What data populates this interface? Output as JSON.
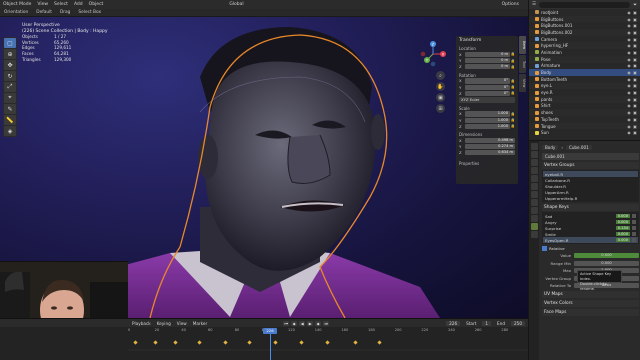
{
  "topbar": {
    "mode": "Object Mode",
    "menus": [
      "View",
      "Select",
      "Add",
      "Object"
    ],
    "transform_orientation": "Global",
    "options": "Options"
  },
  "header2": {
    "orientation_label": "Orientation",
    "orientation_value": "Default",
    "drag_label": "Drag",
    "drag_value": "Select Box"
  },
  "viewport": {
    "title": "User Perspective",
    "subtitle": "(226) Scene Collection | Body : Happy",
    "stats": [
      {
        "k": "Objects",
        "v": "1 / 27"
      },
      {
        "k": "Vertices",
        "v": "65,260"
      },
      {
        "k": "Edges",
        "v": "129,611"
      },
      {
        "k": "Faces",
        "v": "64,281"
      },
      {
        "k": "Triangles",
        "v": "129,300"
      }
    ],
    "gizmo_axes": {
      "x": "X",
      "y": "Y",
      "z": "Z"
    }
  },
  "npanel": {
    "title": "Transform",
    "location_label": "Location",
    "location": [
      {
        "ax": "X",
        "v": "0 m"
      },
      {
        "ax": "Y",
        "v": "0 m"
      },
      {
        "ax": "Z",
        "v": "0 m"
      }
    ],
    "rotation_label": "Rotation",
    "rotation": [
      {
        "ax": "X",
        "v": "0°"
      },
      {
        "ax": "Y",
        "v": "0°"
      },
      {
        "ax": "Z",
        "v": "0°"
      }
    ],
    "rotation_mode": "XYZ Euler",
    "scale_label": "Scale",
    "scale": [
      {
        "ax": "X",
        "v": "1.000"
      },
      {
        "ax": "Y",
        "v": "1.000"
      },
      {
        "ax": "Z",
        "v": "1.000"
      }
    ],
    "dimensions_label": "Dimensions",
    "dimensions": [
      {
        "ax": "X",
        "v": "0.498 m"
      },
      {
        "ax": "Y",
        "v": "0.274 m"
      },
      {
        "ax": "Z",
        "v": "0.634 m"
      }
    ],
    "properties_label": "Properties",
    "tabs": [
      "Item",
      "Tool",
      "View"
    ]
  },
  "timeline": {
    "menus": [
      "Playback",
      "Keying",
      "View",
      "Marker"
    ],
    "current_frame": "226",
    "start_label": "Start",
    "start": "1",
    "end_label": "End",
    "end": "250",
    "ruler": [
      "0",
      "20",
      "40",
      "60",
      "80",
      "100",
      "120",
      "140",
      "160",
      "180",
      "200",
      "220",
      "240",
      "260",
      "280"
    ]
  },
  "outliner": {
    "rows": [
      {
        "name": "rootJoint",
        "color": "#c29450",
        "sel": false
      },
      {
        "name": "BigButtons",
        "color": "#e69a3c",
        "sel": false
      },
      {
        "name": "BigButtons.001",
        "color": "#e69a3c",
        "sel": false
      },
      {
        "name": "BigButtons.002",
        "color": "#e69a3c",
        "sel": false
      },
      {
        "name": "Camera",
        "color": "#6fa0d8",
        "sel": false
      },
      {
        "name": "hyperring_HF",
        "color": "#e69a3c",
        "sel": false
      },
      {
        "name": "Animation",
        "color": "#8fae4a",
        "sel": false
      },
      {
        "name": "Pose",
        "color": "#8fae4a",
        "sel": false
      },
      {
        "name": "Armature",
        "color": "#6fa0d8",
        "sel": false
      },
      {
        "name": "Body",
        "color": "#e69a3c",
        "sel": true
      },
      {
        "name": "BottomTeeth",
        "color": "#e69a3c",
        "sel": false
      },
      {
        "name": "eye.L",
        "color": "#e69a3c",
        "sel": false
      },
      {
        "name": "eye.R",
        "color": "#e69a3c",
        "sel": false
      },
      {
        "name": "pants",
        "color": "#e69a3c",
        "sel": false
      },
      {
        "name": "Shirt",
        "color": "#e69a3c",
        "sel": false
      },
      {
        "name": "shoes",
        "color": "#e69a3c",
        "sel": false
      },
      {
        "name": "TopTeeth",
        "color": "#e69a3c",
        "sel": false
      },
      {
        "name": "Tongue",
        "color": "#e69a3c",
        "sel": false
      },
      {
        "name": "Sun",
        "color": "#e6d23c",
        "sel": false
      }
    ]
  },
  "props": {
    "breadcrumb_obj": "Body",
    "breadcrumb_mesh": "Cube.001",
    "mesh_name": "Cube.001",
    "vertex_groups_label": "Vertex Groups",
    "vertex_groups": [
      "eyeball.R",
      "Collarbone.R",
      "Shoulder.R",
      "UpperArm.R",
      "UpperarmHelp.R"
    ],
    "shape_keys_label": "Shape Keys",
    "shape_keys": [
      {
        "name": "Sad",
        "v": "0.000"
      },
      {
        "name": "Angry",
        "v": "0.000"
      },
      {
        "name": "Surprise",
        "v": "0.134"
      },
      {
        "name": "Smile",
        "v": "0.000"
      },
      {
        "name": "EyesOpen.R",
        "v": "0.000"
      }
    ],
    "relative_label": "Relative",
    "value_label": "Value",
    "value": "0.000",
    "range_min_label": "Range Min",
    "range_min": "0.000",
    "max_label": "Max",
    "max": "1.000",
    "vertex_group_label": "Vertex Group",
    "relative_to_label": "Relative To",
    "relative_to": "Basis",
    "uv_maps_label": "UV Maps",
    "vertex_colors_label": "Vertex Colors",
    "face_maps_label": "Face Maps",
    "tooltip_line1": "Active Shape Key Index.",
    "tooltip_line2": "Double-click to rename."
  }
}
